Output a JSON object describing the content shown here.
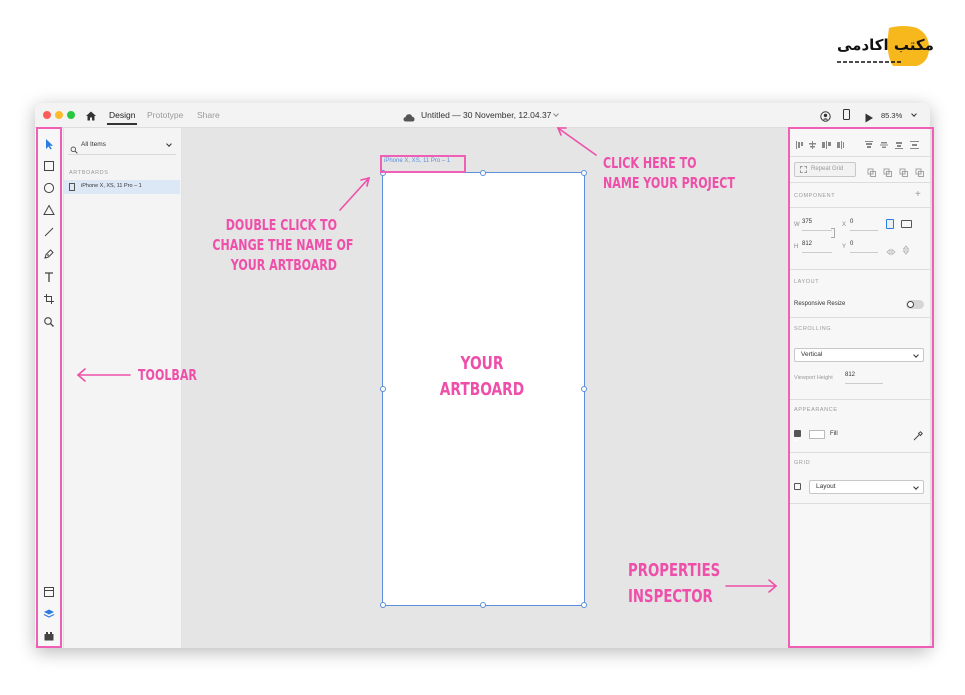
{
  "brand": {
    "logo_text": "مکتب اکادمی"
  },
  "titlebar": {
    "tabs": [
      {
        "label": "Design",
        "active": true
      },
      {
        "label": "Prototype",
        "active": false
      },
      {
        "label": "Share",
        "active": false
      }
    ],
    "document_title": "Untitled — 30 November, 12.04.37",
    "zoom": "85.3%"
  },
  "layers_panel": {
    "search_value": "All Items",
    "section_label": "ARTBOARDS",
    "artboards": [
      "iPhone X, XS, 11 Pro – 1"
    ]
  },
  "canvas": {
    "artboard_name": "iPhone X, XS, 11 Pro – 1"
  },
  "inspector": {
    "repeat_grid_label": "Repeat Grid",
    "component_label": "COMPONENT",
    "w_label": "W",
    "w_value": "375",
    "h_label": "H",
    "h_value": "812",
    "x_label": "X",
    "x_value": "0",
    "y_label": "Y",
    "y_value": "0",
    "layout_label": "LAYOUT",
    "responsive_resize_label": "Responsive Resize",
    "scrolling_label": "SCROLLING",
    "scrolling_value": "Vertical",
    "viewport_height_label": "Viewport Height",
    "viewport_height_value": "812",
    "appearance_label": "APPEARANCE",
    "fill_label": "Fill",
    "grid_label": "GRID",
    "grid_value": "Layout"
  },
  "annotations": {
    "toolbar": "TOOLBAR",
    "artboard_line1": "YOUR",
    "artboard_line2": "ARTBOARD",
    "rename_line1": "DOUBLE CLICK TO",
    "rename_line2": "CHANGE THE NAME OF",
    "rename_line3": "YOUR ARTBOARD",
    "project_line1": "CLICK HERE TO",
    "project_line2": "NAME YOUR PROJECT",
    "inspector_line1": "PROPERTIES",
    "inspector_line2": "INSPECTOR"
  },
  "colors": {
    "annotation_pink": "#ee4fa9",
    "selection_blue": "#5b8fd9",
    "logo_yellow": "#f6b81d"
  }
}
